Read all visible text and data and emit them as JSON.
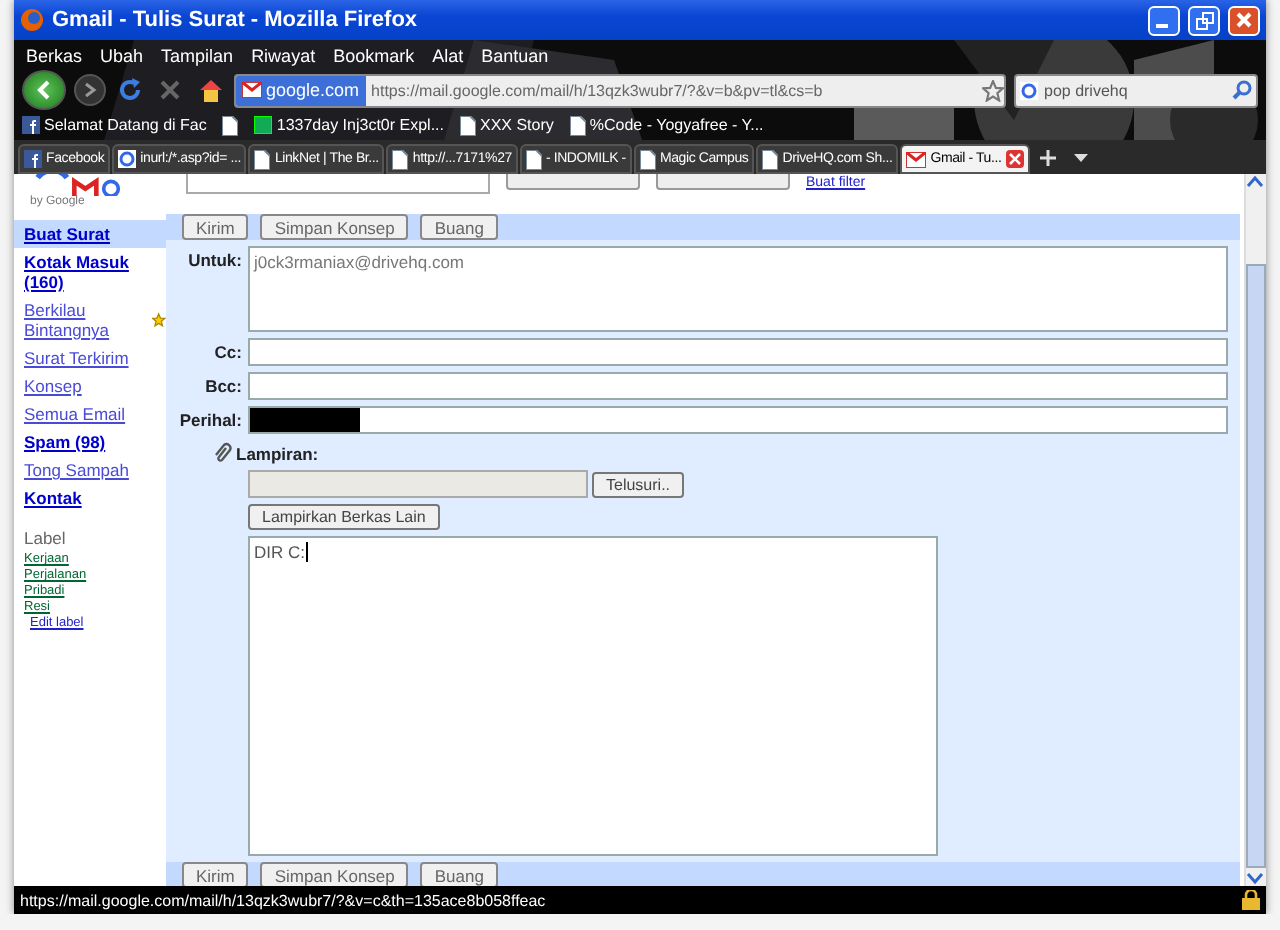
{
  "window": {
    "title": "Gmail - Tulis Surat - Mozilla Firefox"
  },
  "menu": [
    "Berkas",
    "Ubah",
    "Tampilan",
    "Riwayat",
    "Bookmark",
    "Alat",
    "Bantuan"
  ],
  "nav": {
    "identity": "google.com",
    "url": "https://mail.google.com/mail/h/13qzk3wubr7/?&v=b&pv=tl&cs=b",
    "search": "pop drivehq"
  },
  "bookmarks": [
    {
      "label": "Selamat Datang di Fac",
      "kind": "facebook"
    },
    {
      "kind": "page"
    },
    {
      "label": "1337day Inj3ct0r Expl...",
      "kind": "green"
    },
    {
      "label": "XXX Story",
      "kind": "page"
    },
    {
      "label": "%Code - Yogyafree - Y...",
      "kind": "page"
    }
  ],
  "tabs": [
    {
      "label": "Facebook",
      "kind": "facebook",
      "selected": false
    },
    {
      "label": "inurl:/*.asp?id= ...",
      "kind": "google",
      "selected": false
    },
    {
      "label": "LinkNet | The Br...",
      "kind": "page",
      "selected": false
    },
    {
      "label": "http://...7171%27",
      "kind": "page",
      "selected": false
    },
    {
      "label": "- INDOMILK -",
      "kind": "page",
      "selected": false
    },
    {
      "label": "Magic Campus",
      "kind": "page",
      "selected": false
    },
    {
      "label": "DriveHQ.com Sh...",
      "kind": "page",
      "selected": false
    },
    {
      "label": "Gmail - Tu...",
      "kind": "gmail",
      "selected": true
    }
  ],
  "header": {
    "logo_caption": "by Google",
    "filter_link": "Buat filter"
  },
  "sidebar": {
    "items": [
      {
        "label": "Buat Surat",
        "bold": true,
        "selected": true
      },
      {
        "label": "Kotak Masuk (160)",
        "bold": true,
        "selected": false
      },
      {
        "label": "Berkilau Bintangnya",
        "bold": false,
        "selected": false,
        "star": true
      },
      {
        "label": "Surat Terkirim",
        "bold": false,
        "selected": false
      },
      {
        "label": "Konsep",
        "bold": false,
        "selected": false
      },
      {
        "label": "Semua Email",
        "bold": false,
        "selected": false
      },
      {
        "label": "Spam (98)",
        "bold": true,
        "selected": false
      },
      {
        "label": "Tong Sampah",
        "bold": false,
        "selected": false
      },
      {
        "label": "Kontak",
        "bold": true,
        "selected": false
      }
    ],
    "label_heading": "Label",
    "labels": [
      "Kerjaan",
      "Perjalanan",
      "Pribadi",
      "Resi"
    ],
    "edit_labels": "Edit label"
  },
  "compose": {
    "actions": [
      "Kirim",
      "Simpan Konsep",
      "Buang"
    ],
    "to_label": "Untuk:",
    "to": "j0ck3rmaniax@drivehq.com",
    "cc_label": "Cc:",
    "bcc_label": "Bcc:",
    "subject_label": "Perihal:",
    "attach_label": "Lampiran:",
    "browse": "Telusuri..",
    "attach_more": "Lampirkan Berkas Lain",
    "body": "DIR C:",
    "bottom_actions": [
      "Kirim",
      "Simpan Konsep",
      "Buang"
    ]
  },
  "status_bar": {
    "text": "https://mail.google.com/mail/h/13qzk3wubr7/?&v=c&th=135ace8b058ffeac"
  }
}
